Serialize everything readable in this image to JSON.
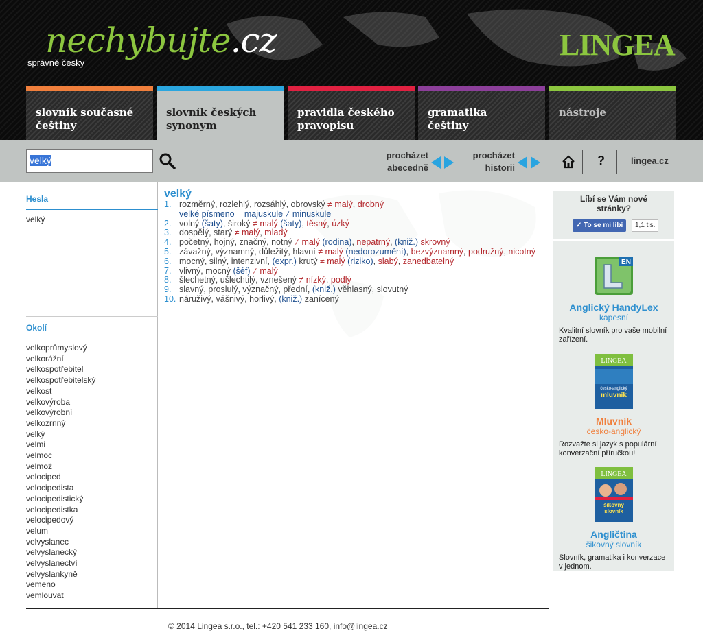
{
  "header": {
    "logo_main": "nechybujte",
    "logo_tld": ".cz",
    "logo_sub": "správně česky",
    "brand": "LINGEA"
  },
  "tabs": [
    {
      "label": "slovník současné češtiny",
      "color": "#f07f3c"
    },
    {
      "label": "slovník českých synonym",
      "color": "#2aa6df",
      "active": true
    },
    {
      "label": "pravidla českého pravopisu",
      "color": "#e02141"
    },
    {
      "label": "gramatika češtiny",
      "color": "#8c3f9a"
    },
    {
      "label": "nástroje",
      "color": "#8cc63f"
    }
  ],
  "toolbar": {
    "search_value": "velký",
    "browse_alpha_1": "procházet",
    "browse_alpha_2": "abecedně",
    "browse_hist_1": "procházet",
    "browse_hist_2": "historii",
    "home_icon": "home-icon",
    "help_label": "?",
    "lingea_link": "lingea.cz",
    "accent": "#29a4e0"
  },
  "left": {
    "hesla_title": "Hesla",
    "hesla_items": [
      "velký"
    ],
    "okoli_title": "Okolí",
    "okoli_items": [
      "velkoprůmyslový",
      "velkorážní",
      "velkospotřebitel",
      "velkospotřebitelský",
      "velkost",
      "velkovýroba",
      "velkovýrobní",
      "velkozrnný",
      "velký",
      "velmi",
      "velmoc",
      "velmož",
      "velociped",
      "velocipedista",
      "velocipedistický",
      "velocipedistka",
      "velocipedový",
      "velum",
      "velvyslanec",
      "velvyslanecký",
      "velvyslanectví",
      "velvyslankyně",
      "vemeno",
      "vemlouvat"
    ]
  },
  "entry": {
    "headword": "velký",
    "senses": [
      {
        "n": "1.",
        "parts": [
          [
            "syn",
            "rozměrný, rozlehlý, rozsáhlý, obrovský "
          ],
          [
            "neq",
            "≠ "
          ],
          [
            "ant",
            "malý"
          ],
          [
            "syn",
            ", "
          ],
          [
            "ant",
            "drobný"
          ]
        ],
        "sub": [
          [
            "lbl",
            "velké písmeno = majuskule ≠ minuskule"
          ]
        ]
      },
      {
        "n": "2.",
        "parts": [
          [
            "syn",
            "volný "
          ],
          [
            "lbl",
            "(šaty)"
          ],
          [
            "syn",
            ", široký "
          ],
          [
            "neq",
            "≠ "
          ],
          [
            "ant",
            "malý "
          ],
          [
            "lbl",
            "(šaty)"
          ],
          [
            "syn",
            ", "
          ],
          [
            "ant",
            "těsný"
          ],
          [
            "syn",
            ", "
          ],
          [
            "ant",
            "úzký"
          ]
        ]
      },
      {
        "n": "3.",
        "parts": [
          [
            "syn",
            "dospělý, starý "
          ],
          [
            "neq",
            "≠ "
          ],
          [
            "ant",
            "malý"
          ],
          [
            "syn",
            ", "
          ],
          [
            "ant",
            "mladý"
          ]
        ]
      },
      {
        "n": "4.",
        "parts": [
          [
            "syn",
            "početný, hojný, značný, notný "
          ],
          [
            "neq",
            "≠ "
          ],
          [
            "ant",
            "malý "
          ],
          [
            "lbl",
            "(rodina)"
          ],
          [
            "syn",
            ", "
          ],
          [
            "ant",
            "nepatrný"
          ],
          [
            "syn",
            ", "
          ],
          [
            "lbl",
            "(kniž.) "
          ],
          [
            "ant",
            "skrovný"
          ]
        ]
      },
      {
        "n": "5.",
        "parts": [
          [
            "syn",
            "závažný, významný, důležitý, hlavní "
          ],
          [
            "neq",
            "≠ "
          ],
          [
            "ant",
            "malý "
          ],
          [
            "lbl",
            "(nedorozumění)"
          ],
          [
            "syn",
            ", "
          ],
          [
            "ant",
            "bezvýznamný"
          ],
          [
            "syn",
            ", "
          ],
          [
            "ant",
            "podružný"
          ],
          [
            "syn",
            ", "
          ],
          [
            "ant",
            "nicotný"
          ]
        ]
      },
      {
        "n": "6.",
        "parts": [
          [
            "syn",
            "mocný, silný, intenzivní, "
          ],
          [
            "lbl",
            "(expr.) "
          ],
          [
            "syn",
            "krutý "
          ],
          [
            "neq",
            "≠ "
          ],
          [
            "ant",
            "malý "
          ],
          [
            "lbl",
            "(riziko)"
          ],
          [
            "syn",
            ", "
          ],
          [
            "ant",
            "slabý"
          ],
          [
            "syn",
            ", "
          ],
          [
            "ant",
            "zanedbatelný"
          ]
        ]
      },
      {
        "n": "7.",
        "parts": [
          [
            "syn",
            "vlivný, mocný "
          ],
          [
            "lbl",
            "(šéf) "
          ],
          [
            "neq",
            "≠ "
          ],
          [
            "ant",
            "malý"
          ]
        ]
      },
      {
        "n": "8.",
        "parts": [
          [
            "syn",
            "šlechetný, ušlechtilý, vznešený "
          ],
          [
            "neq",
            "≠ "
          ],
          [
            "ant",
            "nízký"
          ],
          [
            "syn",
            ", "
          ],
          [
            "ant",
            "podlý"
          ]
        ]
      },
      {
        "n": "9.",
        "parts": [
          [
            "syn",
            "slavný, proslulý, význačný, přední, "
          ],
          [
            "lbl",
            "(kniž.) "
          ],
          [
            "syn",
            "věhlasný, slovutný"
          ]
        ]
      },
      {
        "n": "10.",
        "parts": [
          [
            "syn",
            "náruživý, vášnivý, horlivý, "
          ],
          [
            "lbl",
            "(kniž.) "
          ],
          [
            "syn",
            "zanícený"
          ]
        ]
      }
    ]
  },
  "footer": {
    "text": "© 2014 Lingea s.r.o., tel.: +420 541 233 160, info@lingea.cz"
  },
  "right": {
    "like_title": "Líbí se Vám nové stránky?",
    "fb_button": "To se mi líbí",
    "fb_count": "1,1 tis.",
    "promos": [
      {
        "title": "Anglický HandyLex",
        "subtitle": "kapesní",
        "desc": "Kvalitní slovník pro vaše mobilní zařízení.",
        "title_color": "#2d8fcf",
        "sub_color": "#2d8fcf",
        "badge": "EN"
      },
      {
        "title": "Mluvník",
        "subtitle": "česko-anglický",
        "desc": "Rozvažte si jazyk s populární konverzační příručkou!",
        "title_color": "#f07f3c",
        "sub_color": "#f07f3c",
        "book_brand": "LINGEA",
        "book_line1": "česko-anglický",
        "book_line2": "mluvník"
      },
      {
        "title": "Angličtina",
        "subtitle": "šikovný slovník",
        "desc": "Slovník, gramatika i konverzace v jednom.",
        "title_color": "#2d8fcf",
        "sub_color": "#2d8fcf",
        "book_brand": "LINGEA",
        "book_line1": "šikovný",
        "book_line2": "slovník"
      }
    ]
  }
}
